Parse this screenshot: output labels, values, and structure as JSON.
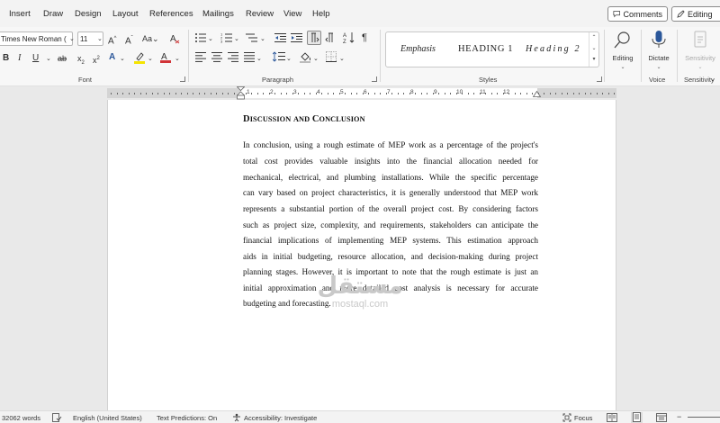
{
  "menu": {
    "items": [
      "Insert",
      "Draw",
      "Design",
      "Layout",
      "References",
      "Mailings",
      "Review",
      "View",
      "Help"
    ],
    "comments_label": "Comments",
    "editing_label": "Editing"
  },
  "ribbon": {
    "font": {
      "family": "Times New Roman (",
      "size": "11",
      "group_label": "Font"
    },
    "paragraph": {
      "group_label": "Paragraph"
    },
    "styles": {
      "group_label": "Styles",
      "items": [
        "Emphasis",
        "HEADING 1",
        "Heading 2"
      ]
    },
    "editing": {
      "label": "Editing"
    },
    "voice": {
      "dictate_label": "Dictate",
      "group_label": "Voice"
    },
    "sensitivity": {
      "button_label": "Sensitivity",
      "group_label": "Sensitivity"
    }
  },
  "ruler": {
    "numbers": [
      "1",
      "2",
      "3",
      "4",
      "5",
      "6",
      "7",
      "8",
      "9",
      "10",
      "11",
      "12"
    ]
  },
  "document": {
    "heading": "Discussion and Conclusion",
    "heading_parts": {
      "d": "D",
      "iscussion": "ISCUSSION",
      "and": "AND",
      "c": "C",
      "onclusion": "ONCLUSION"
    },
    "paragraph_lines": [
      "In conclusion, using a rough estimate of MEP work as a percentage of the project's",
      "total cost provides valuable insights into the financial allocation needed for",
      "mechanical, electrical, and plumbing installations. While the specific percentage",
      "can vary based on project characteristics, it is generally understood that MEP work",
      "represents a substantial portion of the overall project cost. By considering factors",
      "such as project size, complexity, and requirements, stakeholders can anticipate the",
      "financial implications of implementing MEP systems. This estimation approach",
      "aids in initial budgeting, resource allocation, and decision-making during project",
      "planning stages. However, it is important to note that the rough estimate is just an",
      "initial approximation and more detailed cost analysis is necessary for accurate",
      "budgeting and forecasting."
    ]
  },
  "watermark": {
    "arabic": "مستقل",
    "latin": "mostaql.com"
  },
  "status": {
    "words": "32062 words",
    "language": "English (United States)",
    "text_predictions": "Text Predictions: On",
    "accessibility": "Accessibility: Investigate",
    "focus": "Focus"
  },
  "colors": {
    "highlight": "#f5e400",
    "font_color": "#d13438",
    "accent": "#2b579a"
  }
}
